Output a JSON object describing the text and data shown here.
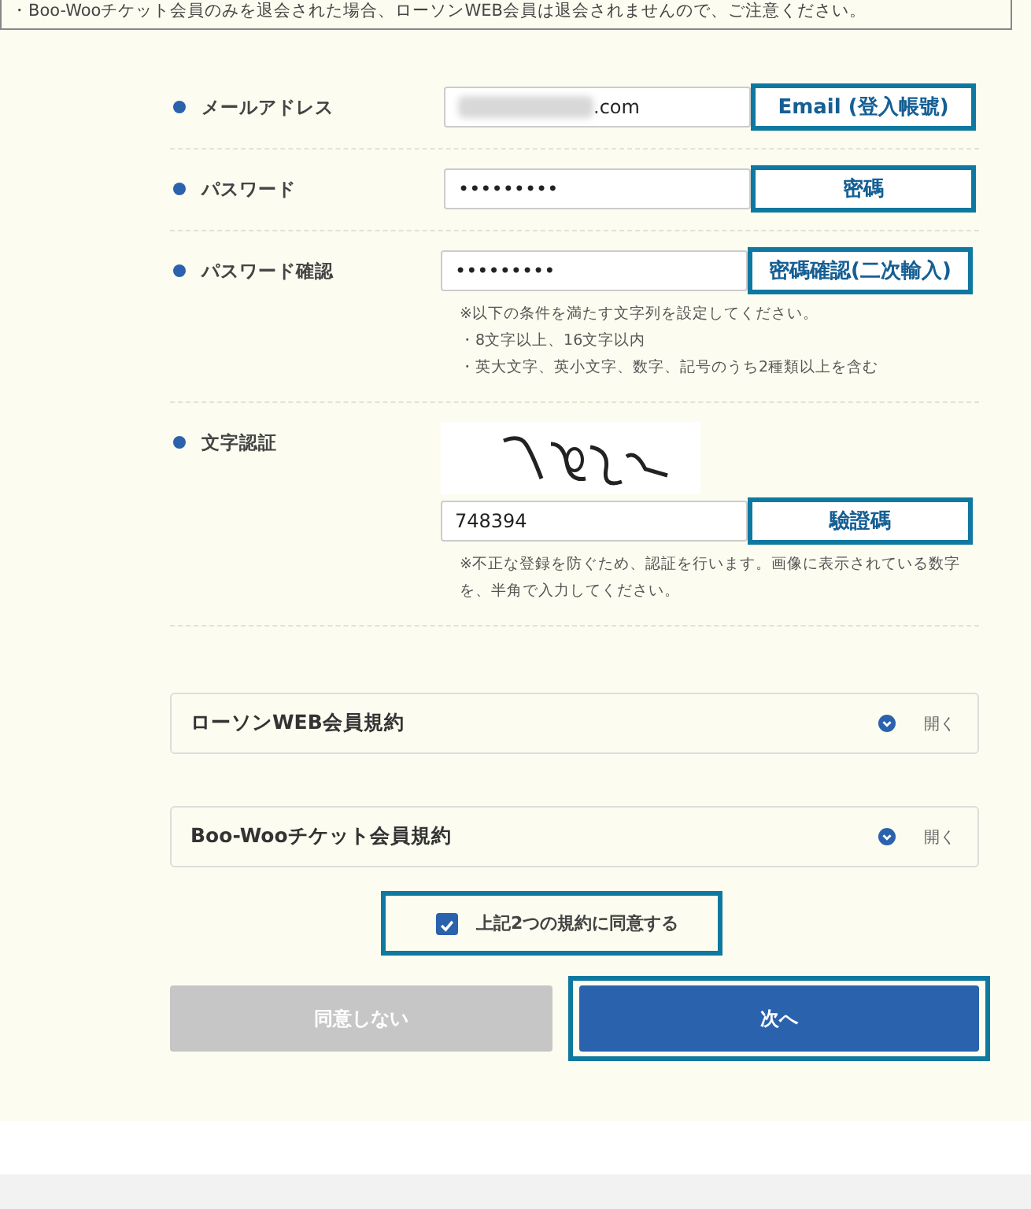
{
  "notice": "・Boo-Wooチケット会員のみを退会された場合、ローソンWEB会員は退会されませんので、ご注意ください。",
  "fields": [
    {
      "label": "メールアドレス",
      "value": ".com",
      "redacted": true,
      "annotation": "Email (登入帳號)"
    },
    {
      "label": "パスワード",
      "value": "•••••••••",
      "redacted": false,
      "annotation": "密碼"
    },
    {
      "label": "パスワード確認",
      "value": "•••••••••",
      "redacted": false,
      "annotation": "密碼確認(二次輸入)",
      "hints": [
        "※以下の条件を満たす文字列を設定してください。",
        "・8文字以上、16文字以内",
        "・英大文字、英小文字、数字、記号のうち2種類以上を含む"
      ]
    }
  ],
  "captcha": {
    "label": "文字認証",
    "value": "748394",
    "annotation": "驗證碼",
    "hint": "※不正な登録を防ぐため、認証を行います。画像に表示されている数字を、半角で入力してください。"
  },
  "terms": [
    {
      "title": "ローソンWEB会員規約",
      "action": "開く"
    },
    {
      "title": "Boo-Wooチケット会員規約",
      "action": "開く"
    }
  ],
  "agree": {
    "label": "上記2つの規約に同意する",
    "checked": true,
    "highlighted": true
  },
  "buttons": [
    {
      "label": "同意しない",
      "kind": "secondary",
      "highlighted": false
    },
    {
      "label": "次へ",
      "kind": "primary",
      "highlighted": true
    }
  ]
}
